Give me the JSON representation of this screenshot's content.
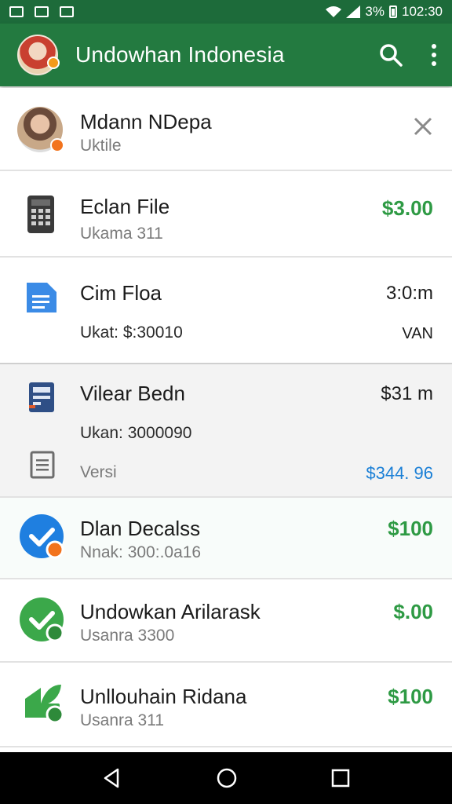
{
  "status": {
    "battery": "3%",
    "time": "102:30"
  },
  "app_bar": {
    "title": "Undowhan Indonesia",
    "actions": [
      "search-icon",
      "more-vert-icon"
    ]
  },
  "rows": [
    {
      "title": "Mdann NDepa",
      "subtitle": "Uktile",
      "right": ""
    },
    {
      "title": "Eclan File",
      "subtitle": "Ukama 311",
      "right": "$3.00"
    },
    {
      "title": "Cim Floa",
      "subtitle": "Ukat: $:30010",
      "right": "3:0:m",
      "right_secondary": "VAN"
    },
    {
      "title": "Vilear Bedn",
      "subtitle": "Ukan: 3000090",
      "subtitle2": "Versi",
      "right": "$31 m",
      "right_secondary": "$344. 96"
    },
    {
      "title": "Dlan Decalss",
      "subtitle": "Nnak: 300:.0a16",
      "right": "$100"
    },
    {
      "title": "Undowkan Arilarask",
      "subtitle": "Usanra 3300",
      "right": "$.00"
    },
    {
      "title": "Unllouhain Ridana",
      "subtitle": "Usanra 311",
      "right": "$100"
    }
  ],
  "colors": {
    "app_bar": "#237a40",
    "status_bar": "#1d6b3a",
    "accent_green": "#2e9a44",
    "accent_blue": "#1a7fd6"
  }
}
